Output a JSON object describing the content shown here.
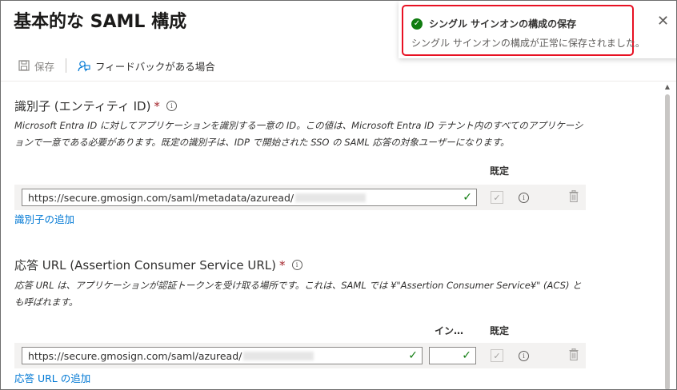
{
  "page": {
    "title": "基本的な SAML 構成"
  },
  "toolbar": {
    "save_label": "保存",
    "feedback_label": "フィードバックがある場合"
  },
  "identifier": {
    "label": "識別子 (エンティティ ID)",
    "required_mark": "*",
    "description": "Microsoft Entra ID に対してアプリケーションを識別する一意の ID。この値は、Microsoft Entra ID テナント内のすべてのアプリケーションで一意である必要があります。既定の識別子は、IDP で開始された SSO の SAML 応答の対象ユーザーになります。",
    "default_header": "既定",
    "value": "https://secure.gmosign.com/saml/metadata/azuread/",
    "add_link": "識別子の追加"
  },
  "reply_url": {
    "label": "応答 URL (Assertion Consumer Service URL)",
    "required_mark": "*",
    "description": "応答 URL は、アプリケーションが認証トークンを受け取る場所です。これは、SAML では ¥\"Assertion Consumer Service¥\" (ACS) とも呼ばれます。",
    "index_header": "イン…",
    "default_header": "既定",
    "value": "https://secure.gmosign.com/saml/azuread/",
    "index_value": "",
    "add_link": "応答 URL の追加"
  },
  "toast": {
    "title": "シングル サインオンの構成の保存",
    "message": "シングル サインオンの構成が正常に保存されました。",
    "status_icon": "success-check-icon",
    "highlight_color": "#e81123"
  },
  "colors": {
    "accent": "#0078d4",
    "success": "#107c10",
    "required": "#a4262c"
  }
}
